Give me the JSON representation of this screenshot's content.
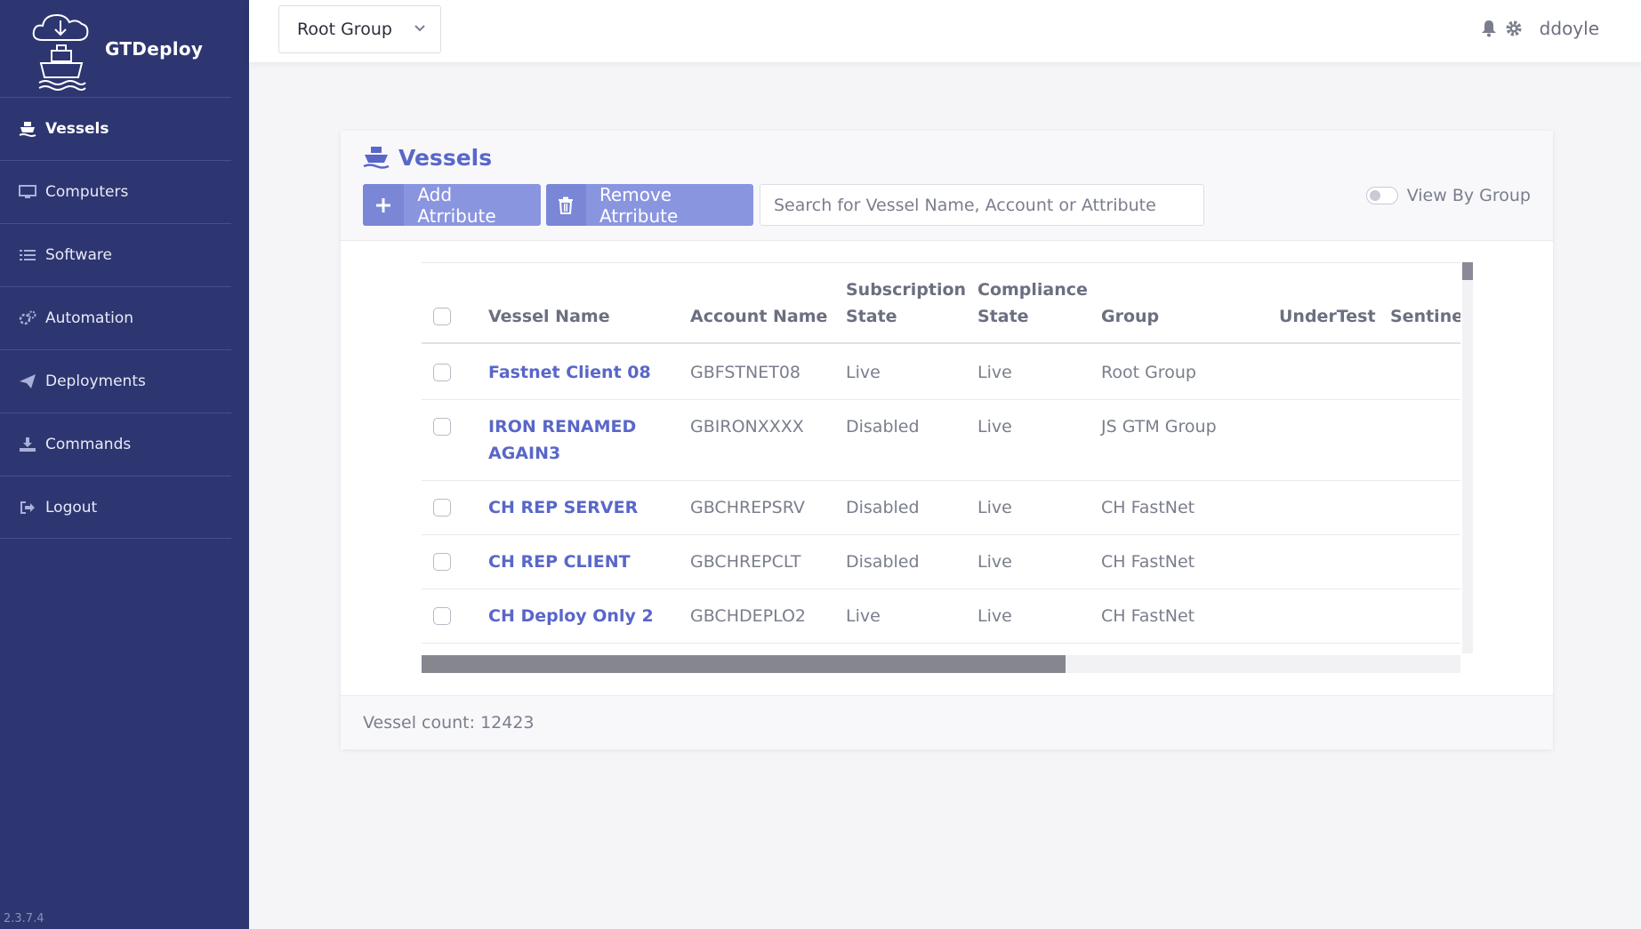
{
  "app": {
    "name": "GTDeploy",
    "version": "2.3.7.4"
  },
  "sidebar": {
    "items": [
      {
        "label": "Vessels",
        "icon": "ship-icon",
        "active": true
      },
      {
        "label": "Computers",
        "icon": "monitor-icon"
      },
      {
        "label": "Software",
        "icon": "list-icon"
      },
      {
        "label": "Automation",
        "icon": "gears-icon"
      },
      {
        "label": "Deployments",
        "icon": "paper-plane-icon"
      },
      {
        "label": "Commands",
        "icon": "download-icon"
      },
      {
        "label": "Logout",
        "icon": "logout-icon"
      }
    ]
  },
  "topbar": {
    "group_select": "Root Group",
    "username": "ddoyle"
  },
  "page": {
    "title": "Vessels",
    "add_attribute_label": "Add Atrribute",
    "remove_attribute_label": "Remove Atrribute",
    "search_placeholder": "Search for Vessel Name, Account or Attribute",
    "view_by_group_label": "View By Group",
    "view_by_group_on": false
  },
  "table": {
    "columns": {
      "vessel_name": "Vessel Name",
      "account_name": "Account Name",
      "subscription_state_1": "Subscription",
      "subscription_state_2": "State",
      "compliance_state_1": "Compliance",
      "compliance_state_2": "State",
      "group": "Group",
      "undertest": "UnderTest",
      "sentinel": "Sentinel"
    },
    "rows": [
      {
        "vessel_name_1": "Fastnet Client 08",
        "vessel_name_2": "",
        "account": "GBFSTNET08",
        "subscription": "Live",
        "compliance": "Live",
        "group": "Root Group"
      },
      {
        "vessel_name_1": "IRON RENAMED",
        "vessel_name_2": "AGAIN3",
        "account": "GBIRONXXXX",
        "subscription": "Disabled",
        "compliance": "Live",
        "group": "JS GTM Group"
      },
      {
        "vessel_name_1": "CH REP SERVER",
        "vessel_name_2": "",
        "account": "GBCHREPSRV",
        "subscription": "Disabled",
        "compliance": "Live",
        "group": "CH FastNet"
      },
      {
        "vessel_name_1": "CH REP CLIENT",
        "vessel_name_2": "",
        "account": "GBCHREPCLT",
        "subscription": "Disabled",
        "compliance": "Live",
        "group": "CH FastNet"
      },
      {
        "vessel_name_1": "CH Deploy Only 2",
        "vessel_name_2": "",
        "account": "GBCHDEPLO2",
        "subscription": "Live",
        "compliance": "Live",
        "group": "CH FastNet"
      }
    ],
    "horizontal_scroll_fraction": 0.62
  },
  "footer": {
    "vessel_count": "Vessel count: 12423"
  },
  "colors": {
    "sidebar": "#2d3670",
    "accent": "#5967c9",
    "button": "#8a95e0"
  }
}
